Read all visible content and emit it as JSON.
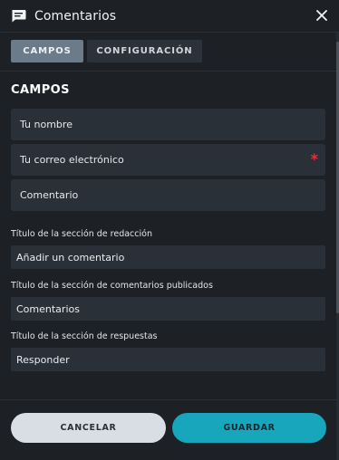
{
  "header": {
    "title": "Comentarios",
    "icon": "chat-icon",
    "close_icon": "close-icon"
  },
  "tabs": [
    {
      "label": "CAMPOS",
      "active": true
    },
    {
      "label": "CONFIGURACIÓN",
      "active": false
    }
  ],
  "section": {
    "title": "CAMPOS"
  },
  "fields": [
    {
      "label": "Tu nombre",
      "required": false
    },
    {
      "label": "Tu correo electrónico",
      "required": true,
      "required_mark": "*"
    },
    {
      "label": "Comentario",
      "required": false
    }
  ],
  "settings": [
    {
      "label": "Título de la sección de redacción",
      "value": "Añadir un comentario"
    },
    {
      "label": "Título de la sección de comentarios publicados",
      "value": "Comentarios"
    },
    {
      "label": "Título de la sección de respuestas",
      "value": "Responder"
    }
  ],
  "buttons": {
    "cancel": "CANCELAR",
    "save": "GUARDAR"
  },
  "colors": {
    "background": "#1d2126",
    "accent": "#17a6bb",
    "required": "#e0313f",
    "tab_active": "#6b7b89"
  }
}
